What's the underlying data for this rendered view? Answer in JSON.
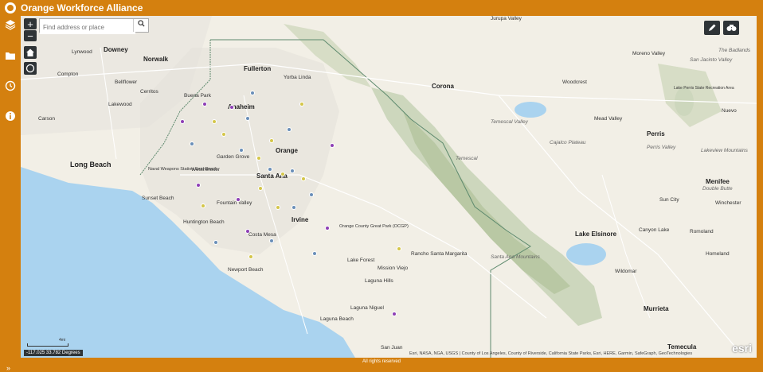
{
  "app": {
    "title": "Orange Workforce Alliance"
  },
  "sidebar": {
    "items": [
      {
        "icon": "layers-icon"
      },
      {
        "icon": "folder-icon"
      },
      {
        "icon": "history-icon"
      },
      {
        "icon": "info-icon"
      }
    ],
    "collapse": "»"
  },
  "search": {
    "placeholder": "Find address or place"
  },
  "zoom": {
    "in": "+",
    "out": "−"
  },
  "coords": "-117.025 33.782 Degrees",
  "scale_label": "4mi",
  "attribution": "Esri, NASA, NGA, USGS | County of Los Angeles, County of Riverside, California State Parks, Esri, HERE, Garmin, SafeGraph, GeoTechnologies",
  "footer": "All rights reserved",
  "esri_logo": "esri",
  "colors": {
    "accent": "#d4800f",
    "ocean": "#aad3ef",
    "point_blue": "#6a8fb8",
    "point_yellow": "#d4c64a",
    "point_purple": "#8e3fb5"
  },
  "places": {
    "downey": "Downey",
    "norwalk": "Norwalk",
    "compton": "Compton",
    "bellflower": "Bellflower",
    "cerritos": "Cerritos",
    "lakewood": "Lakewood",
    "carson": "Carson",
    "long_beach": "Long Beach",
    "lynwood": "Lynwood",
    "buena_park": "Buena Park",
    "fullerton": "Fullerton",
    "anaheim": "Anaheim",
    "yorba_linda": "Yorba Linda",
    "corona": "Corona",
    "orange": "Orange",
    "garden_grove": "Garden Grove",
    "westminster": "Westminster",
    "santa_ana": "Santa Ana",
    "fountain_valley": "Fountain Valley",
    "huntington_beach": "Huntington Beach",
    "costa_mesa": "Costa Mesa",
    "irvine": "Irvine",
    "newport_beach": "Newport Beach",
    "lake_forest": "Lake Forest",
    "mission_viejo": "Mission Viejo",
    "rancho_santa_margarita": "Rancho Santa Margarita",
    "laguna_hills": "Laguna Hills",
    "laguna_niguel": "Laguna Niguel",
    "san_juan": "San Juan",
    "lake_elsinore": "Lake Elsinore",
    "canyon_lake": "Canyon Lake",
    "wildomar": "Wildomar",
    "murrieta": "Murrieta",
    "menifee": "Menifee",
    "perris": "Perris",
    "moreno_valley": "Moreno Valley",
    "mead_valley": "Mead Valley",
    "woodcrest": "Woodcrest",
    "sun_city": "Sun City",
    "winchester": "Winchester",
    "temecula": "Temecula",
    "jurupa_valley": "Jurupa Valley",
    "perris_valley": "Perris Valley",
    "lakeview": "Lakeview Mountains",
    "double_butte": "Double Butte",
    "temescal_valley": "Temescal Valley",
    "cajalco_plateau": "Cajalco Plateau",
    "badlands": "The Badlands",
    "san_jacinto_valley": "San Jacinto Valley",
    "lake_perris": "Lake Perris State Recreation Area",
    "sunset_beach": "Sunset Beach",
    "naval_weapons": "Naval Weapons Station Seal Beach",
    "orange_county_park": "Orange County Great Park (OCGP)",
    "santa_ana_mtns": "Santa Ana Mountains",
    "homeland": "Homeland",
    "romoland": "Romoland",
    "nuevo": "Nuevo",
    "laguna_beach": "Laguna Beach",
    "temescal": "Temescal"
  }
}
